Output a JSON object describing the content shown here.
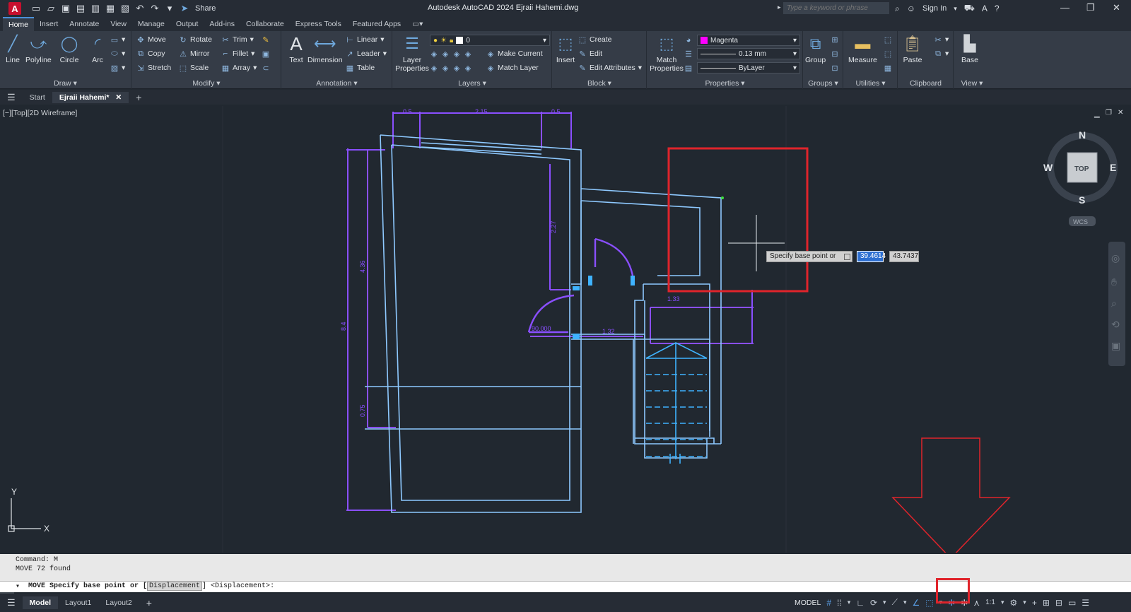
{
  "app": {
    "logo": "A",
    "title": "Autodesk AutoCAD 2024   Ejraii Hahemi.dwg",
    "share_label": "Share",
    "search_placeholder": "Type a keyword or phrase",
    "sign_in": "Sign In"
  },
  "ribbon_tabs": [
    "Home",
    "Insert",
    "Annotate",
    "View",
    "Manage",
    "Output",
    "Add-ins",
    "Collaborate",
    "Express Tools",
    "Featured Apps"
  ],
  "ribbon": {
    "draw": {
      "title": "Draw",
      "line": "Line",
      "polyline": "Polyline",
      "circle": "Circle",
      "arc": "Arc"
    },
    "modify": {
      "title": "Modify",
      "move": "Move",
      "rotate": "Rotate",
      "trim": "Trim",
      "copy": "Copy",
      "mirror": "Mirror",
      "fillet": "Fillet",
      "stretch": "Stretch",
      "scale": "Scale",
      "array": "Array"
    },
    "annotation": {
      "title": "Annotation",
      "text": "Text",
      "dimension": "Dimension",
      "linear": "Linear",
      "leader": "Leader",
      "table": "Table"
    },
    "layers": {
      "title": "Layers",
      "layer_properties": "Layer Properties",
      "current_layer": "0",
      "make_current": "Make Current",
      "match_layer": "Match Layer"
    },
    "block": {
      "title": "Block",
      "insert": "Insert",
      "create": "Create",
      "edit": "Edit",
      "edit_attributes": "Edit Attributes"
    },
    "properties": {
      "title": "Properties",
      "match_properties": "Match Properties",
      "color": "Magenta",
      "color_hex": "#ff00ff",
      "lineweight": "0.13 mm",
      "linetype": "ByLayer"
    },
    "groups": {
      "title": "Groups",
      "group": "Group"
    },
    "utilities": {
      "title": "Utilities",
      "measure": "Measure"
    },
    "clipboard": {
      "title": "Clipboard",
      "paste": "Paste"
    },
    "view": {
      "title": "View",
      "base": "Base"
    }
  },
  "file_tabs": {
    "start": "Start",
    "active": "Ejraii Hahemi*"
  },
  "viewport": {
    "label": "[−][Top][2D Wireframe]",
    "viewcube": {
      "n": "N",
      "s": "S",
      "e": "E",
      "w": "W",
      "top": "TOP",
      "wcs": "WCS"
    },
    "dims": {
      "d1": "0.5",
      "d2": "2.15",
      "d3": "0.5",
      "d4": "4.36",
      "d5": "8.4",
      "d6": "0.75",
      "d7": "2.27",
      "d8": "1.33",
      "d9": "1.32",
      "d10": "90.000"
    },
    "prompt": "Specify base point or",
    "x_value": "39.4614",
    "y_value": "43.7437",
    "ucs_x": "X",
    "ucs_y": "Y"
  },
  "command": {
    "line1": "Command: M",
    "line2": "MOVE 72 found",
    "prompt_prefix": "MOVE Specify base point or [",
    "prompt_option": "Displacement",
    "prompt_suffix": "] <Displacement>:"
  },
  "layout_tabs": [
    "Model",
    "Layout1",
    "Layout2"
  ],
  "status": {
    "model": "MODEL",
    "scale": "1:1"
  },
  "colors": {
    "accent": "#4a90d9",
    "highlight_red": "#e0242b",
    "wall_blue": "#8ec9ff",
    "dim_purple": "#8a4fff",
    "stair_cyan": "#3fb3ff"
  }
}
